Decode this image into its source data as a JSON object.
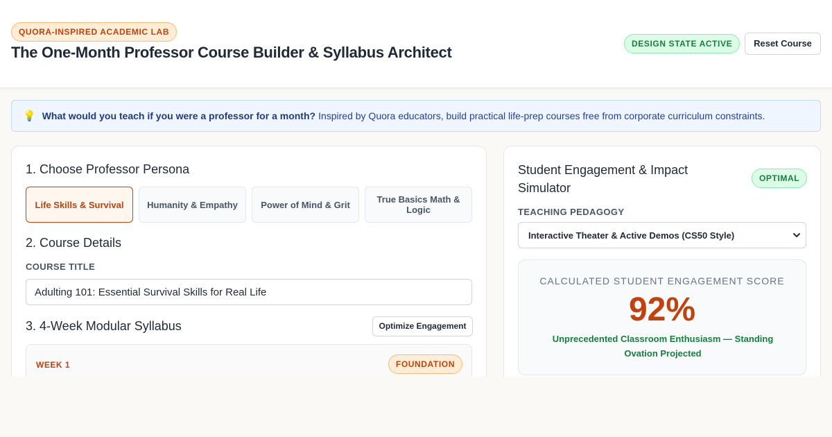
{
  "header": {
    "lab_badge": "QUORA-INSPIRED ACADEMIC LAB",
    "title": "The One-Month Professor Course Builder & Syllabus Architect",
    "state_badge": "DESIGN STATE ACTIVE",
    "reset_label": "Reset Course"
  },
  "info": {
    "icon": "lightbulb-icon",
    "question": "What would you teach if you were a professor for a month?",
    "text": "Inspired by Quora educators, build practical life-prep courses free from corporate curriculum constraints."
  },
  "builder": {
    "persona_heading": "1. Choose Professor Persona",
    "personas": [
      {
        "label": "Life Skills & Survival",
        "active": true
      },
      {
        "label": "Humanity & Empathy",
        "active": false
      },
      {
        "label": "Power of Mind & Grit",
        "active": false
      },
      {
        "label": "True Basics Math & Logic",
        "active": false
      }
    ],
    "details_heading": "2. Course Details",
    "course_title_label": "COURSE TITLE",
    "course_title_value": "Adulting 101: Essential Survival Skills for Real Life",
    "syllabus_heading": "3. 4-Week Modular Syllabus",
    "optimize_label": "Optimize Engagement",
    "weeks": [
      {
        "label": "WEEK 1",
        "tag": "FOUNDATION"
      }
    ]
  },
  "simulator": {
    "title": "Student Engagement & Impact Simulator",
    "status_badge": "OPTIMAL",
    "pedagogy_label": "TEACHING PEDAGOGY",
    "pedagogy_selected": "Interactive Theater & Active Demos (CS50 Style)",
    "score_caption": "CALCULATED STUDENT ENGAGEMENT SCORE",
    "score_value": "92%",
    "verdict": "Unprecedented Classroom Enthusiasm — Standing Ovation Projected"
  },
  "colors": {
    "accent": "#c2410c",
    "success": "#15803d",
    "info": "#1e40af"
  }
}
